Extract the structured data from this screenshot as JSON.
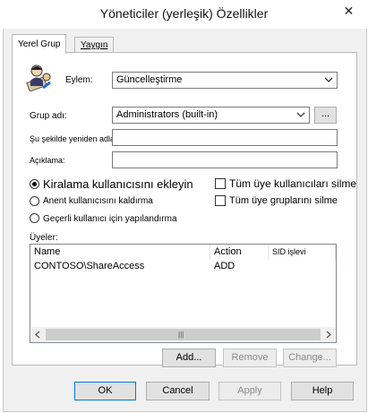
{
  "window": {
    "title": "Yöneticiler (yerleşik) Özellikler",
    "close_glyph": "✕"
  },
  "tabs": [
    {
      "label": "Yerel Grup"
    },
    {
      "label": "Yaygın"
    }
  ],
  "form": {
    "action_label": "Eylem:",
    "action_value": "Güncelleştirme",
    "group_name_label": "Grup adı:",
    "group_name_value": "Administrators (built-in)",
    "browse_label": "...",
    "rename_label": "Şu şekilde yeniden adlandır:",
    "rename_value": "",
    "description_label": "Açıklama:",
    "description_value": ""
  },
  "options": {
    "radio_add_current": "Kiralama kullanıcısını ekleyin",
    "radio_remove_current": "Anent kullanıcısını kaldırma",
    "radio_do_not_configure": "Geçerli kullanıcı için yapılandırma",
    "check_delete_all_users": "Tüm üye kullanıcıları silme",
    "check_delete_all_groups": "Tüm üye gruplarını silme",
    "selected_radio": "radio_add_current"
  },
  "members": {
    "label": "Üyeler:",
    "columns": [
      "Name",
      "Action",
      "SID işlevi"
    ],
    "rows": [
      {
        "name": "CONTOSO\\ShareAccess",
        "action": "ADD",
        "sid": ""
      }
    ],
    "scroll_grip": "|||"
  },
  "member_buttons": {
    "add": "Add...",
    "remove": "Remove",
    "change": "Change..."
  },
  "dialog_buttons": {
    "ok": "OK",
    "cancel": "Cancel",
    "apply": "Apply",
    "help": "Help"
  }
}
